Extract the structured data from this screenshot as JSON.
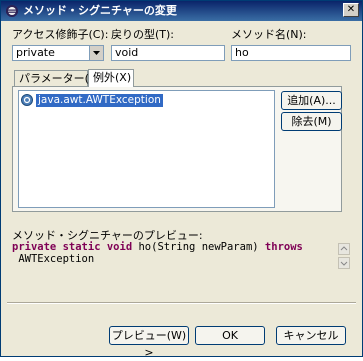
{
  "dialog": {
    "title": "メソッド・シグニチャーの変更"
  },
  "fields": {
    "access_label": "アクセス修飾子(C):",
    "access_value": "private",
    "return_label": "戻りの型(T):",
    "return_value": "void",
    "name_label": "メソッド名(N):",
    "name_value": "ho"
  },
  "tabs": [
    {
      "label": "パラメーター(R)"
    },
    {
      "label": "例外(X)"
    }
  ],
  "exceptions": {
    "items": [
      {
        "label": "java.awt.AWTException"
      }
    ],
    "add_button": "追加(A)...",
    "remove_button": "除去(M)"
  },
  "preview": {
    "label": "メソッド・シグニチャーのプレビュー:",
    "kw_private": "private",
    "kw_static": "static",
    "kw_void": "void",
    "signature_mid": " ho(String newParam) ",
    "kw_throws": "throws",
    "line2": " AWTException"
  },
  "buttons": {
    "preview": "プレビュー(W) >",
    "ok": "OK",
    "cancel": "キャンセル"
  },
  "colors": {
    "title_bar": "#0a246a",
    "keyword": "#7f0055",
    "selection": "#316ac5"
  }
}
